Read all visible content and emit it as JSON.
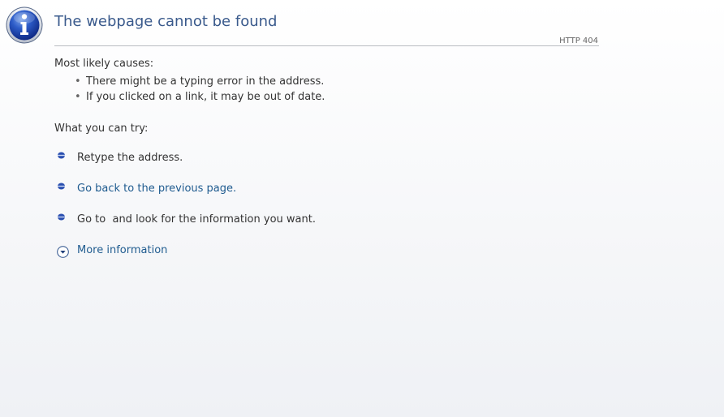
{
  "page": {
    "title": "The webpage cannot be found",
    "http_code": "HTTP 404"
  },
  "causes": {
    "heading": "Most likely causes:",
    "items": [
      "There might be a typing error in the address.",
      "If you clicked on a link, it may be out of date."
    ]
  },
  "try": {
    "heading": "What you can try:",
    "retype": "Retype the address.",
    "go_back": "Go back to the previous page.",
    "go_to": "Go to  and look for the information you want.",
    "more_info": "More information"
  },
  "colors": {
    "title": "#3a5a8c",
    "link": "#1f5b8f",
    "text": "#333333"
  },
  "icons": {
    "header": "info-icon",
    "bullets": "blue-bullet-icon",
    "more": "expand-chevron-icon"
  }
}
